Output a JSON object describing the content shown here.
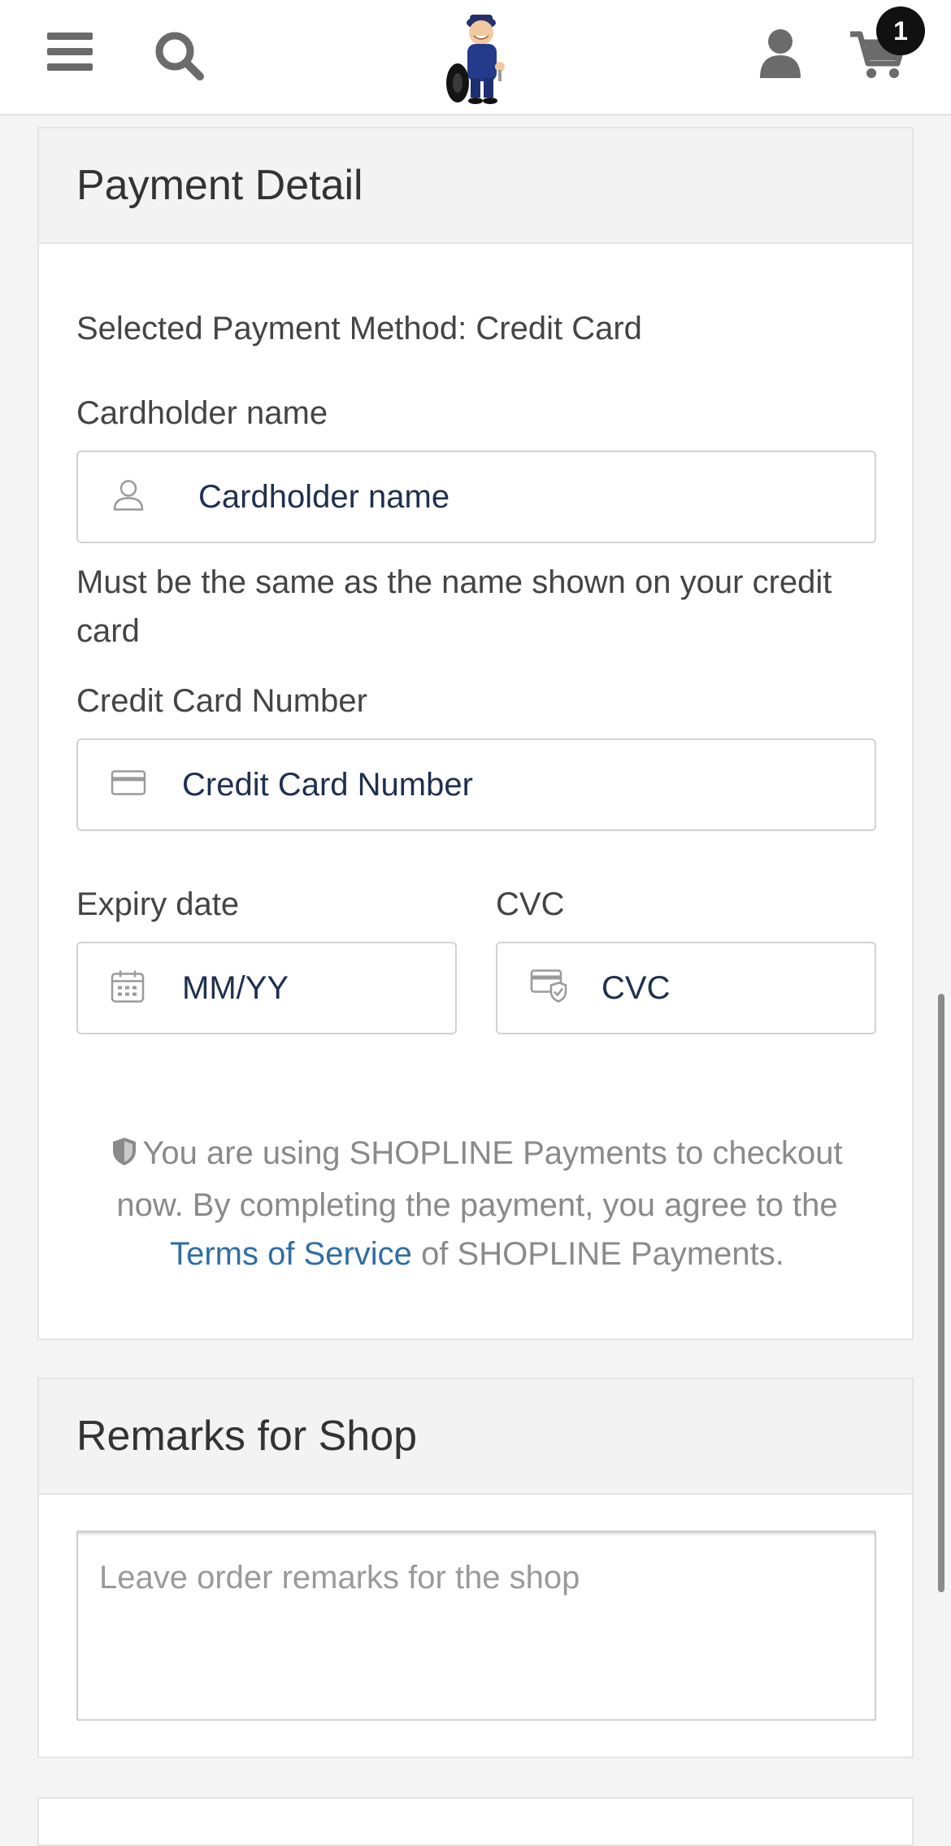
{
  "header": {
    "menu_icon": "hamburger-menu-icon",
    "search_icon": "search-icon",
    "logo_icon": "mechanic-mascot-logo",
    "user_icon": "user-icon",
    "cart_icon": "shopping-cart-icon",
    "cart_count": "1"
  },
  "payment": {
    "title": "Payment Detail",
    "method_label": "Selected Payment Method: Credit Card",
    "cardholder": {
      "label": "Cardholder name",
      "placeholder": "Cardholder name",
      "hint": "Must be the same as the name shown on your credit card"
    },
    "card_number": {
      "label": "Credit Card Number",
      "placeholder": "Credit Card Number"
    },
    "expiry": {
      "label": "Expiry date",
      "placeholder": "MM/YY"
    },
    "cvc": {
      "label": "CVC",
      "placeholder": "CVC"
    },
    "secure_text_before": "You are using SHOPLINE Payments to checkout now. By completing the payment, you agree to the",
    "terms_link": "Terms of Service",
    "secure_text_after": "of SHOPLINE Payments."
  },
  "remarks": {
    "title": "Remarks for Shop",
    "placeholder": "Leave order remarks for the shop"
  },
  "colors": {
    "link": "#2f6ea3",
    "input_text": "#1e3050",
    "badge": "#111111"
  }
}
